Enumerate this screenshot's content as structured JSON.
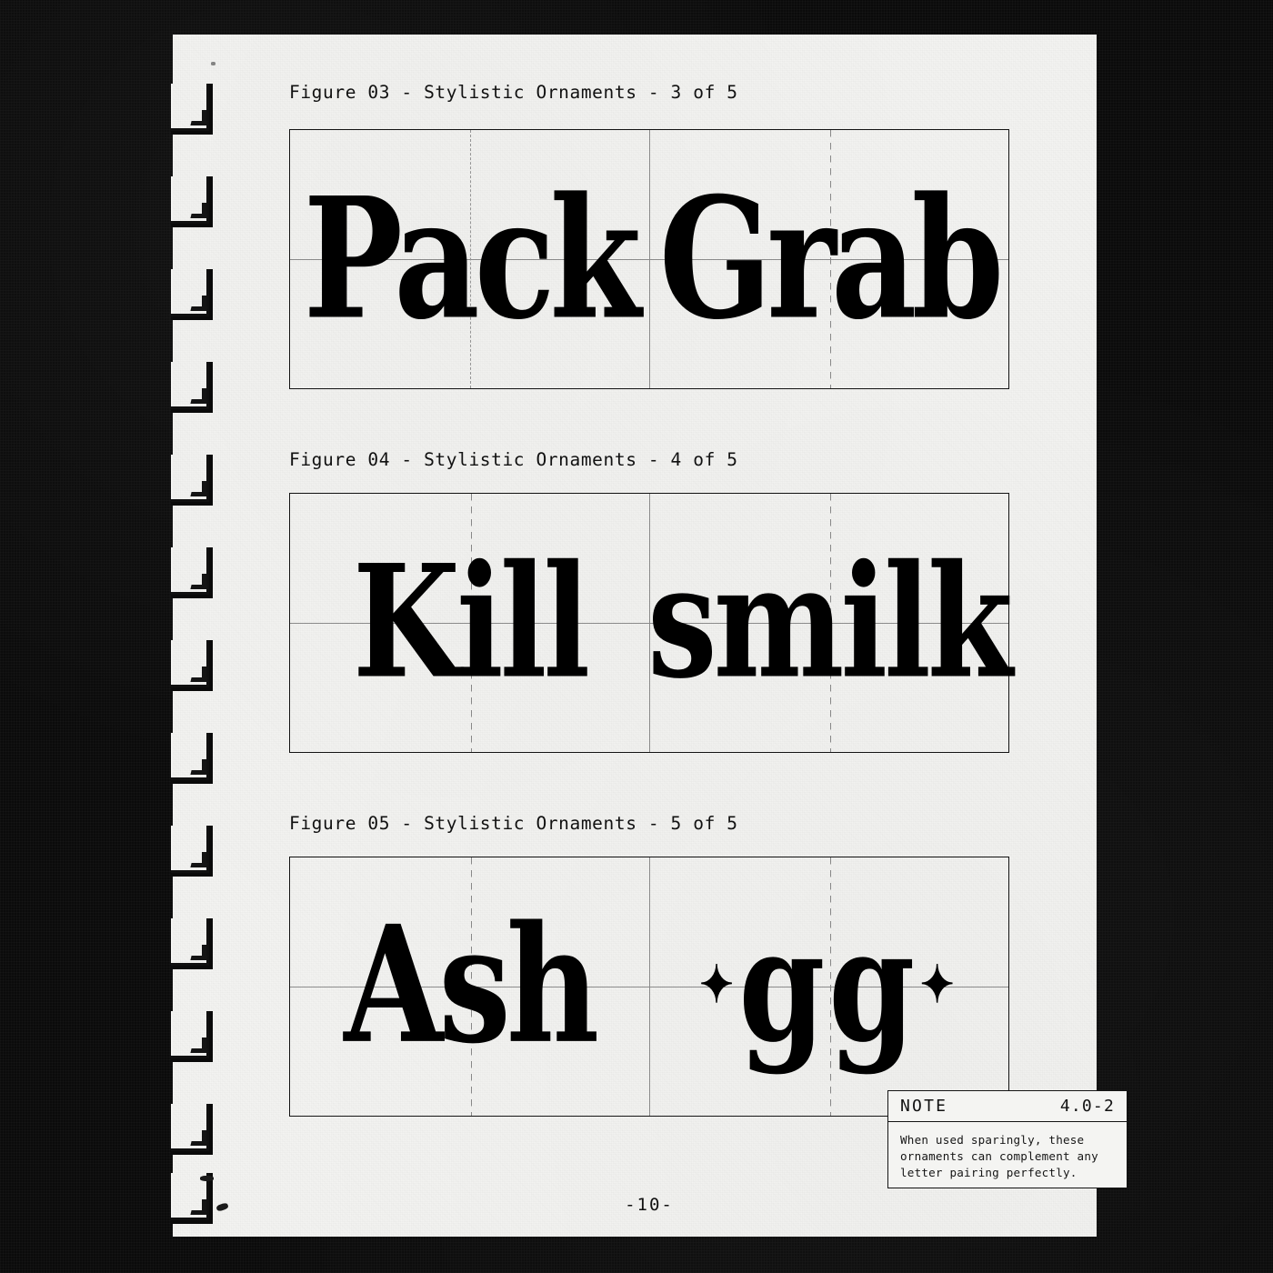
{
  "page": {
    "page_number": "-10-",
    "paper_color": "#f4f4f2",
    "ink_color": "#141414",
    "backdrop_color": "#0b0b0b",
    "grid_color": "#8e8e8e"
  },
  "figures": [
    {
      "caption": "Figure 03 - Stylistic Ornaments - 3 of 5",
      "cells": [
        {
          "word": "Pack",
          "style": "blackletter",
          "ornament": ""
        },
        {
          "word": "Grab",
          "style": "blackletter",
          "ornament": ""
        }
      ]
    },
    {
      "caption": "Figure 04 - Stylistic Ornaments - 4 of 5",
      "cells": [
        {
          "word": "Kill",
          "style": "blackletter",
          "ornament": "✦"
        },
        {
          "word": "smilk",
          "style": "blackletter",
          "ornament": "✦"
        }
      ]
    },
    {
      "caption": "Figure 05 - Stylistic Ornaments - 5 of 5",
      "cells": [
        {
          "word": "Ash",
          "style": "blackletter",
          "ornament": ""
        },
        {
          "word": "gg",
          "style": "blackletter-ornamented",
          "ornament": "✦"
        }
      ]
    }
  ],
  "note": {
    "title": "NOTE",
    "code": "4.0-2",
    "line1": "When used sparingly, these",
    "line2": "ornaments can complement any",
    "line3": "letter pairing perfectly."
  }
}
